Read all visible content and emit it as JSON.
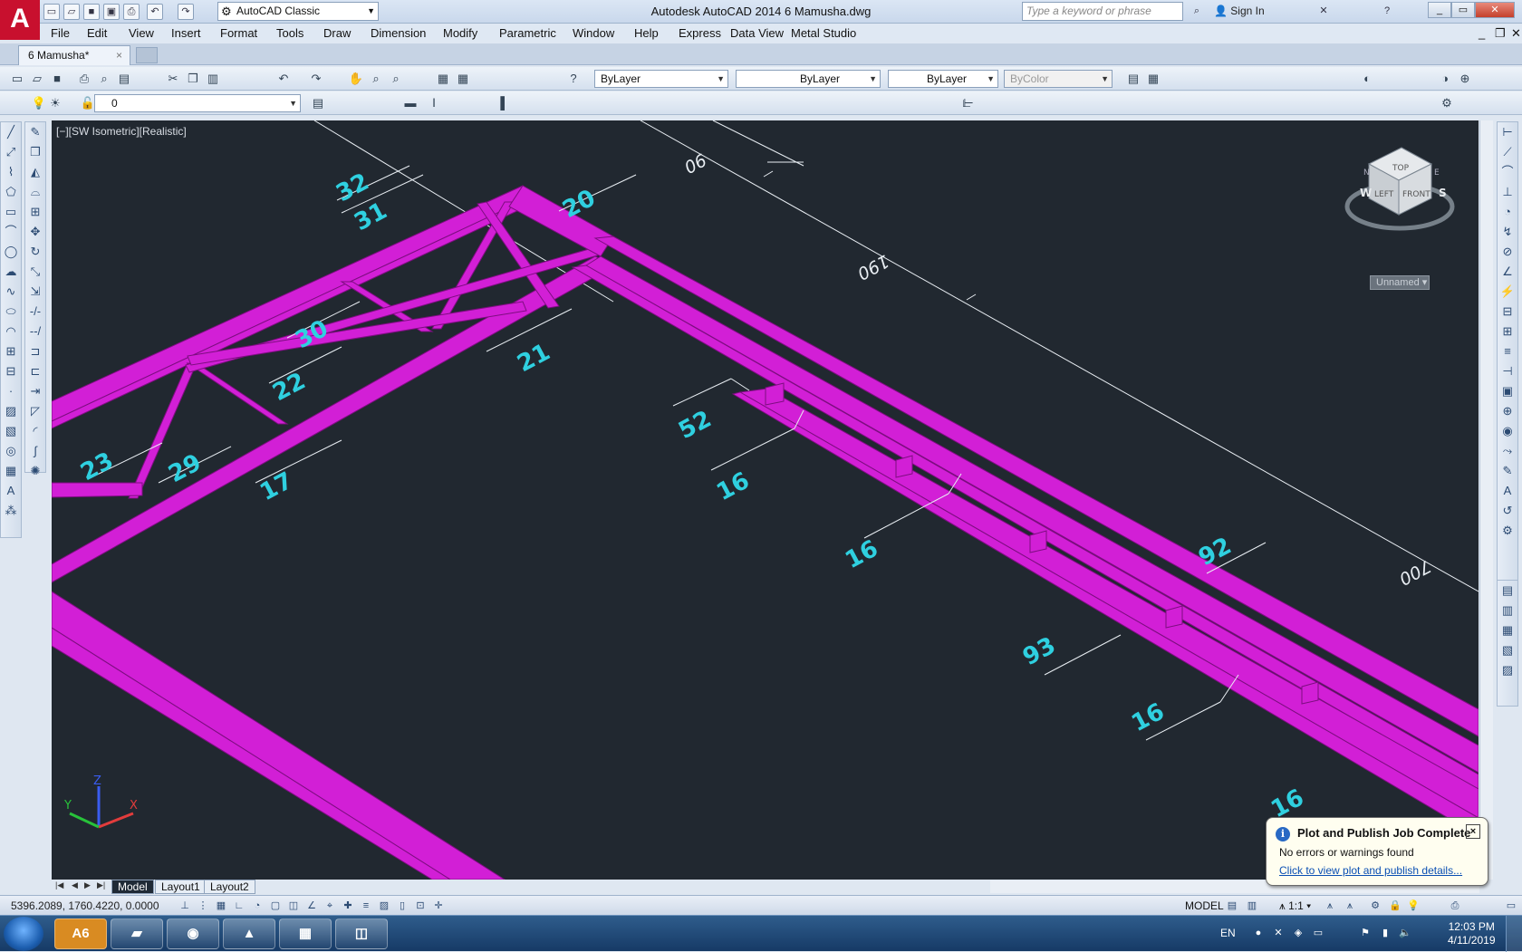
{
  "titlebar": {
    "app_logo": "A",
    "workspace": "AutoCAD Classic",
    "title": "Autodesk AutoCAD 2014    6 Mamusha.dwg",
    "search_placeholder": "Type a keyword or phrase",
    "sign_in": "Sign In"
  },
  "menu": [
    "File",
    "Edit",
    "View",
    "Insert",
    "Format",
    "Tools",
    "Draw",
    "Dimension",
    "Modify",
    "Parametric",
    "Window",
    "Help",
    "Express",
    "Data View",
    "Metal Studio"
  ],
  "doc_tab": {
    "label": "6 Mamusha*",
    "close": "×"
  },
  "properties": {
    "color": "ByLayer",
    "linetype": "ByLayer",
    "lineweight": "ByLayer",
    "plotstyle": "ByColor",
    "layer": "0"
  },
  "viewport": {
    "label": "[−][SW Isometric][Realistic]",
    "balloons": [
      "32",
      "31",
      "20",
      "30",
      "22",
      "21",
      "23",
      "29",
      "17",
      "52",
      "16",
      "16",
      "92",
      "93",
      "16",
      "16"
    ],
    "dimensions": [
      "90",
      "190",
      "700"
    ],
    "viewcube": {
      "top": "TOP",
      "left": "LEFT",
      "front": "FRONT",
      "n": "N",
      "e": "E",
      "w": "W",
      "s": "S",
      "ucs_name": "Unnamed"
    },
    "ucs": {
      "x": "X",
      "y": "Y",
      "z": "Z"
    }
  },
  "layout_tabs": [
    "Model",
    "Layout1",
    "Layout2"
  ],
  "status": {
    "coords": "5396.2089, 1760.4220, 0.0000",
    "model": "MODEL",
    "scale": "1:1"
  },
  "notification": {
    "title": "Plot and Publish Job Complete",
    "body": "No errors or warnings found",
    "link": "Click to view plot and publish details...",
    "close": "×"
  },
  "taskbar": {
    "apps": [
      "A6",
      "",
      "",
      "",
      "",
      ""
    ],
    "lang": "EN",
    "time": "12:03 PM",
    "date": "4/11/2019"
  }
}
